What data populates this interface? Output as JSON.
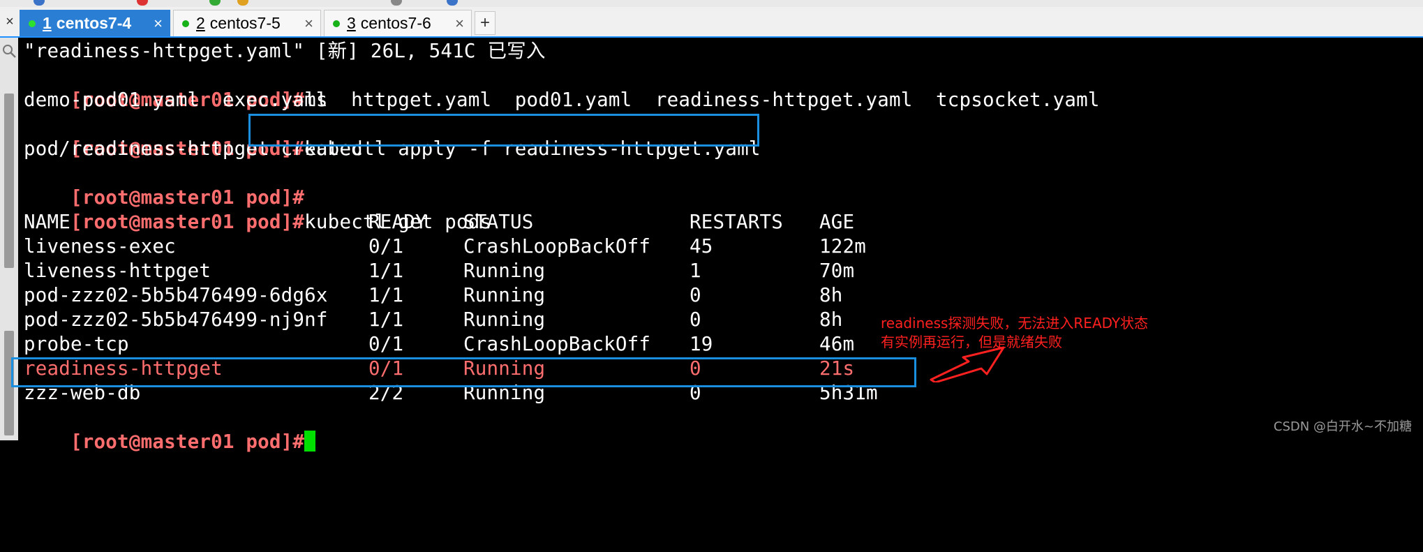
{
  "tabs": [
    {
      "num": "1",
      "label": "centos7-4",
      "active": true
    },
    {
      "num": "2",
      "label": "centos7-5",
      "active": false
    },
    {
      "num": "3",
      "label": "centos7-6",
      "active": false
    }
  ],
  "tab_close": "×",
  "tab_add": "+",
  "close_all": "×",
  "terminal": {
    "line1": "\"readiness-httpget.yaml\" [新] 26L, 541C 已写入",
    "prompt": "[root@master01 pod]#",
    "cmd_ls": "ls",
    "ls_output": "demo-pod01.yaml  exec.yaml  httpget.yaml  pod01.yaml  readiness-httpget.yaml  tcpsocket.yaml",
    "cmd_apply": "kubectl apply -f readiness-httpget.yaml",
    "apply_output": "pod/readiness-httpget created",
    "cmd_get": "kubectl get pods",
    "table_headers": [
      "NAME",
      "READY",
      "STATUS",
      "RESTARTS",
      "AGE"
    ],
    "pods": [
      {
        "name": "liveness-exec",
        "ready": "0/1",
        "status": "CrashLoopBackOff",
        "restarts": "45",
        "age": "122m"
      },
      {
        "name": "liveness-httpget",
        "ready": "1/1",
        "status": "Running",
        "restarts": "1",
        "age": "70m"
      },
      {
        "name": "pod-zzz02-5b5b476499-6dg6x",
        "ready": "1/1",
        "status": "Running",
        "restarts": "0",
        "age": "8h"
      },
      {
        "name": "pod-zzz02-5b5b476499-nj9nf",
        "ready": "1/1",
        "status": "Running",
        "restarts": "0",
        "age": "8h"
      },
      {
        "name": "probe-tcp",
        "ready": "0/1",
        "status": "CrashLoopBackOff",
        "restarts": "19",
        "age": "46m"
      },
      {
        "name": "readiness-httpget",
        "ready": "0/1",
        "status": "Running",
        "restarts": "0",
        "age": "21s"
      },
      {
        "name": "zzz-web-db",
        "ready": "2/2",
        "status": "Running",
        "restarts": "0",
        "age": "5h31m"
      }
    ]
  },
  "annotation": {
    "line1": "readiness探测失败，无法进入READY状态",
    "line2": "有实例再运行，但是就绪失败"
  },
  "watermark": "CSDN @白开水~不加糖",
  "colors": {
    "background": "#000000",
    "prompt": "#ff6e6e",
    "highlight_box": "#1a8fe0",
    "annotation": "#ff2020",
    "cursor": "#00e000",
    "tab_active": "#2a7fd4"
  }
}
